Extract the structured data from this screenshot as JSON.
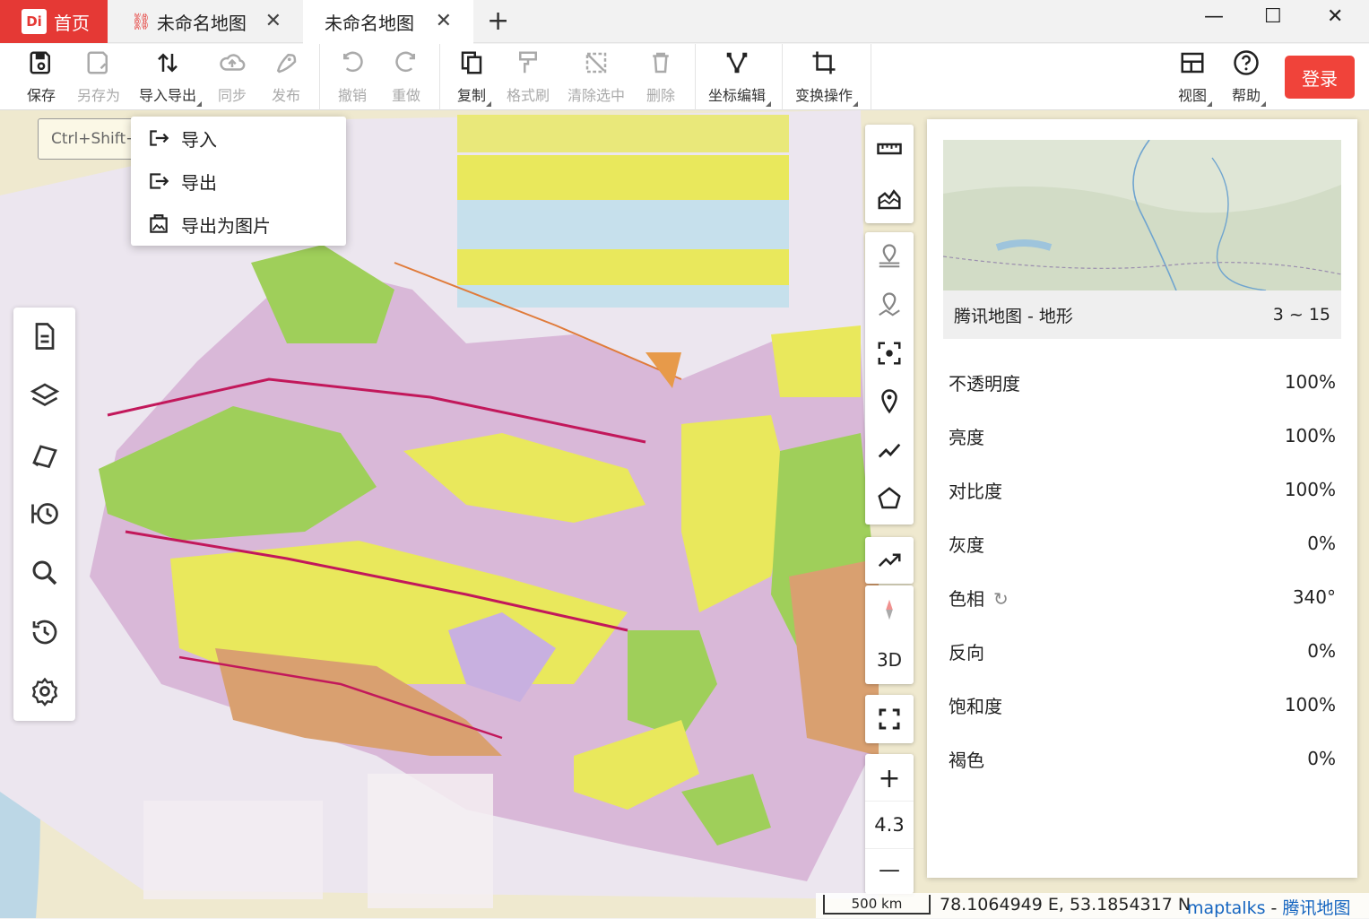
{
  "titlebar": {
    "home_logo": "Di",
    "home_label": "首页",
    "tabs": [
      {
        "label": "未命名地图",
        "close": "✕"
      },
      {
        "label": "未命名地图",
        "close": "✕"
      }
    ],
    "new_tab": "+",
    "window": {
      "minimize": "—",
      "maximize": "☐",
      "close": "✕"
    }
  },
  "toolbar": {
    "save": "保存",
    "save_as": "另存为",
    "import_export": "导入导出",
    "sync": "同步",
    "publish": "发布",
    "undo": "撤销",
    "redo": "重做",
    "copy": "复制",
    "format_brush": "格式刷",
    "clear_selection": "清除选中",
    "delete": "删除",
    "coord_edit": "坐标编辑",
    "transform": "变换操作",
    "view": "视图",
    "help": "帮助",
    "login": "登录"
  },
  "import_menu": {
    "tooltip": "Ctrl+Shift+S",
    "items": [
      "导入",
      "导出",
      "导出为图片"
    ]
  },
  "map_tools": {
    "three_d": "3D",
    "zoom_in": "+",
    "zoom_level": "4.3",
    "zoom_out": "—"
  },
  "layer_panel": {
    "layer_name": "腾讯地图 - 地形",
    "zoom_range": "3 ~ 15",
    "properties": [
      {
        "label": "不透明度",
        "value": "100%"
      },
      {
        "label": "亮度",
        "value": "100%"
      },
      {
        "label": "对比度",
        "value": "100%"
      },
      {
        "label": "灰度",
        "value": "0%"
      },
      {
        "label": "色相",
        "value": "340°"
      },
      {
        "label": "反向",
        "value": "0%"
      },
      {
        "label": "饱和度",
        "value": "100%"
      },
      {
        "label": "褐色",
        "value": "0%"
      }
    ]
  },
  "status": {
    "scale": "500 km",
    "coordinates": "78.1064949 E, 53.1854317 N",
    "attribution_engine": "maptalks",
    "attribution_sep": " - ",
    "attribution_tiles": "腾讯地图"
  }
}
